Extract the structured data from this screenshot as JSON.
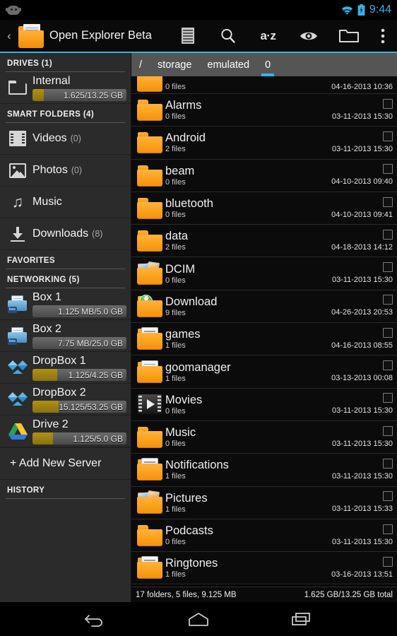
{
  "status_bar": {
    "left_icon": "cyanogenmod-head-icon",
    "wifi_icon": "wifi-icon",
    "battery_icon": "battery-charging-icon",
    "clock": "9:44",
    "accent": "#33b5e5"
  },
  "action_bar": {
    "up_caret": "‹",
    "app_icon": "open-folder-icon",
    "title": "Open Explorer Beta",
    "actions": [
      {
        "name": "view-mode-list",
        "icon": "list-view-icon",
        "label": ""
      },
      {
        "name": "search",
        "icon": "search-icon",
        "label": ""
      },
      {
        "name": "sort",
        "icon": "a-z-icon",
        "label": "a·z"
      },
      {
        "name": "show-hidden",
        "icon": "eye-icon",
        "label": ""
      },
      {
        "name": "new-folder",
        "icon": "folder-icon",
        "label": ""
      },
      {
        "name": "overflow",
        "icon": "overflow-menu-icon",
        "label": ""
      }
    ]
  },
  "sidebar": {
    "sections": [
      {
        "title": "DRIVES (1)"
      },
      {
        "title": "SMART FOLDERS (4)"
      },
      {
        "title": "FAVORITES"
      },
      {
        "title": "NETWORKING (5)"
      },
      {
        "title": "HISTORY"
      }
    ],
    "drives": [
      {
        "name": "Internal",
        "icon": "folder-outline-icon",
        "meter_label": "1.625/13.25 GB",
        "meter_pct": 12
      }
    ],
    "smart_folders": [
      {
        "name": "Videos",
        "count": "(0)",
        "icon": "film-icon"
      },
      {
        "name": "Photos",
        "count": "(0)",
        "icon": "photo-icon"
      },
      {
        "name": "Music",
        "count": "",
        "icon": "music-note-icon"
      },
      {
        "name": "Downloads",
        "count": "(8)",
        "icon": "download-arrow-icon"
      }
    ],
    "networking": [
      {
        "name": "Box 1",
        "icon": "box-icon",
        "meter_label": "1.125 MB/5.0 GB",
        "meter_pct": 0
      },
      {
        "name": "Box 2",
        "icon": "box-icon",
        "meter_label": "7.75 MB/25.0 GB",
        "meter_pct": 0
      },
      {
        "name": "DropBox 1",
        "icon": "dropbox-icon",
        "meter_label": "1.125/4.25 GB",
        "meter_pct": 26
      },
      {
        "name": "DropBox 2",
        "icon": "dropbox-icon",
        "meter_label": "15.125/53.25 GB",
        "meter_pct": 28
      },
      {
        "name": "Drive 2",
        "icon": "google-drive-icon",
        "meter_label": "1.125/5.0 GB",
        "meter_pct": 22
      }
    ],
    "add_server_label": "+ Add New Server"
  },
  "breadcrumbs": [
    {
      "label": "/",
      "selected": false
    },
    {
      "label": "storage",
      "selected": false
    },
    {
      "label": "emulated",
      "selected": false
    },
    {
      "label": "0",
      "selected": true
    }
  ],
  "files": [
    {
      "name": "",
      "icon": "folder-plain-icon",
      "sub": "0 files",
      "date": "04-16-2013 10:36",
      "clipped": true,
      "checked": false
    },
    {
      "name": "Alarms",
      "icon": "folder-plain-icon",
      "sub": "0 files",
      "date": "03-11-2013 15:30",
      "checked": false
    },
    {
      "name": "Android",
      "icon": "folder-plain-icon",
      "sub": "2 files",
      "date": "03-11-2013 15:30",
      "checked": false
    },
    {
      "name": "beam",
      "icon": "folder-plain-icon",
      "sub": "0 files",
      "date": "04-10-2013 09:40",
      "checked": false
    },
    {
      "name": "bluetooth",
      "icon": "folder-plain-icon",
      "sub": "0 files",
      "date": "04-10-2013 09:41",
      "checked": false
    },
    {
      "name": "data",
      "icon": "folder-plain-icon",
      "sub": "2 files",
      "date": "04-18-2013 14:12",
      "checked": false
    },
    {
      "name": "DCIM",
      "icon": "folder-pictures-icon",
      "sub": "0 files",
      "date": "03-11-2013 15:30",
      "checked": false
    },
    {
      "name": "Download",
      "icon": "folder-download-icon",
      "sub": "9 files",
      "date": "04-26-2013 20:53",
      "checked": false
    },
    {
      "name": "games",
      "icon": "folder-documents-icon",
      "sub": "1 files",
      "date": "04-16-2013 08:55",
      "checked": false
    },
    {
      "name": "goomanager",
      "icon": "folder-documents-icon",
      "sub": "1 files",
      "date": "03-13-2013 00:08",
      "checked": false
    },
    {
      "name": "Movies",
      "icon": "folder-movies-icon",
      "sub": "0 files",
      "date": "03-11-2013 15:30",
      "checked": false
    },
    {
      "name": "Music",
      "icon": "folder-plain-icon",
      "sub": "0 files",
      "date": "03-11-2013 15:30",
      "checked": false
    },
    {
      "name": "Notifications",
      "icon": "folder-documents-icon",
      "sub": "1 files",
      "date": "03-11-2013 15:30",
      "checked": false
    },
    {
      "name": "Pictures",
      "icon": "folder-pictures-icon",
      "sub": "1 files",
      "date": "03-11-2013 15:33",
      "checked": false
    },
    {
      "name": "Podcasts",
      "icon": "folder-plain-icon",
      "sub": "0 files",
      "date": "03-11-2013 15:30",
      "checked": false
    },
    {
      "name": "Ringtones",
      "icon": "folder-documents-icon",
      "sub": "1 files",
      "date": "03-16-2013 13:51",
      "checked": false
    }
  ],
  "pane_status": {
    "left": "17 folders, 5 files, 9.125 MB",
    "right": "1.625 GB/13.25 GB total"
  },
  "nav_bar": [
    {
      "name": "back-button",
      "icon": "back-arrow-icon"
    },
    {
      "name": "home-button",
      "icon": "home-icon"
    },
    {
      "name": "recents-button",
      "icon": "recents-icon"
    }
  ]
}
